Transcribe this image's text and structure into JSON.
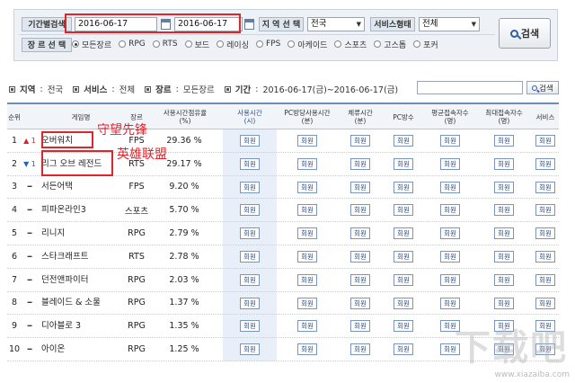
{
  "filters": {
    "period_label": "기간별검색",
    "date_from": "2016-06-17",
    "date_to": "2016-06-17",
    "region_label": "지 역 선 택",
    "region_value": "전국",
    "service_label": "서비스형태",
    "service_value": "전체",
    "search_label": "검색",
    "genre_label": "장 르 선 택",
    "genres": [
      "모든장르",
      "RPG",
      "RTS",
      "보드",
      "레이싱",
      "FPS",
      "아케이드",
      "스포츠",
      "고스톱",
      "포커"
    ],
    "selected_genre_index": 0
  },
  "summary": {
    "region_label": "지역",
    "region_value": "전국",
    "service_label": "서비스",
    "service_value": "전체",
    "genre_label": "장르",
    "genre_value": "모든장르",
    "period_label": "기간",
    "period_value": "2016-06-17(금)~2016-06-17(금)",
    "search_label": "검색"
  },
  "table": {
    "headers": {
      "rank": "순위",
      "name": "게임명",
      "genre": "장르",
      "rate": "사용시간점유율\n(%)",
      "use_time": "사용시간\n(시)",
      "pc_use_time": "PC방당사용시간\n(분)",
      "stay_time": "체류시간\n(분)",
      "pc_count": "PC방수",
      "avg_users": "평균접속자수\n(명)",
      "max_users": "최대접속자수\n(명)",
      "service": "서비스"
    },
    "button_label": "회원",
    "rows": [
      {
        "rank": "1",
        "move": "▲ 1",
        "move_dir": "up",
        "name": "오버워치",
        "genre": "FPS",
        "rate": "29.36 %"
      },
      {
        "rank": "2",
        "move": "▼ 1",
        "move_dir": "down",
        "name": "리그 오브 레전드",
        "genre": "RTS",
        "rate": "29.17 %"
      },
      {
        "rank": "3",
        "move": "━",
        "move_dir": "same",
        "name": "서든어택",
        "genre": "FPS",
        "rate": "9.20 %"
      },
      {
        "rank": "4",
        "move": "━",
        "move_dir": "same",
        "name": "피파온라인3",
        "genre": "스포츠",
        "rate": "5.70 %"
      },
      {
        "rank": "5",
        "move": "━",
        "move_dir": "same",
        "name": "리니지",
        "genre": "RPG",
        "rate": "2.79 %"
      },
      {
        "rank": "6",
        "move": "━",
        "move_dir": "same",
        "name": "스타크래프트",
        "genre": "RTS",
        "rate": "2.78 %"
      },
      {
        "rank": "7",
        "move": "━",
        "move_dir": "same",
        "name": "던전앤파이터",
        "genre": "RPG",
        "rate": "2.03 %"
      },
      {
        "rank": "8",
        "move": "━",
        "move_dir": "same",
        "name": "블레이드 & 소울",
        "genre": "RPG",
        "rate": "1.37 %"
      },
      {
        "rank": "9",
        "move": "━",
        "move_dir": "same",
        "name": "디아블로 3",
        "genre": "RPG",
        "rate": "1.35 %"
      },
      {
        "rank": "10",
        "move": "━",
        "move_dir": "same",
        "name": "아이온",
        "genre": "RPG",
        "rate": "1.25 %"
      }
    ]
  },
  "annotations": {
    "overwatch_cn": "守望先锋",
    "lol_cn": "英雄联盟"
  },
  "watermark": {
    "logo": "下载吧",
    "site": "www.xiazaiba.com"
  },
  "colors": {
    "annotation_red": "#e0242a",
    "header_blue": "#2b4f88",
    "up_arrow": "#d9232a",
    "down_arrow": "#2c62b5"
  }
}
